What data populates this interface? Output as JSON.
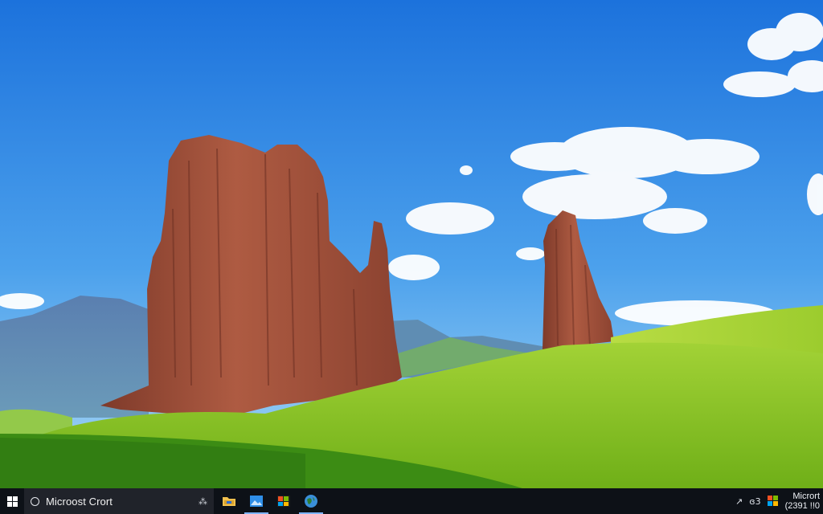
{
  "desktop": {
    "wallpaper": "desert-rock-spires-green-hills",
    "colors": {
      "sky_top": "#1f78e0",
      "sky_bottom": "#8fcaf2",
      "rock": "#a4523c",
      "grass": "#8fc624",
      "grass_dark": "#2f7a11"
    }
  },
  "taskbar": {
    "start_icon": "windows-logo-icon",
    "search": {
      "label": "Microost Crort",
      "icon": "search-circle-icon",
      "mic_icon": "microphone-icon",
      "mic_glyph": "⁂"
    },
    "apps": [
      {
        "name": "file-explorer",
        "icon": "folder-icon"
      },
      {
        "name": "photos",
        "icon": "photos-icon"
      },
      {
        "name": "store",
        "icon": "store-icon"
      },
      {
        "name": "browser",
        "icon": "globe-icon"
      }
    ],
    "tray": {
      "arrow_glyph": "↗",
      "network_text": "ɞ3",
      "clock_top": "Micrort",
      "clock_bottom": "(2391 !!0"
    }
  }
}
